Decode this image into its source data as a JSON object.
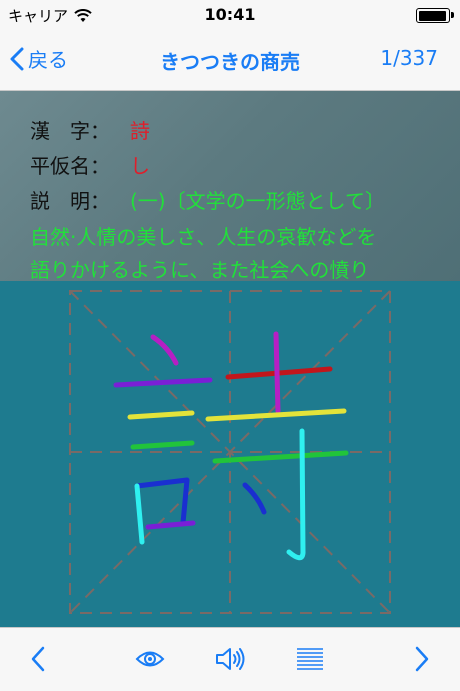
{
  "status": {
    "carrier": "キャリア",
    "time": "10:41",
    "battery_level": 0.95
  },
  "nav": {
    "back_label": "戻る",
    "title": "きつつきの商売",
    "count": "1/337"
  },
  "info": {
    "kanji_label": "漢　字：",
    "kanji_value": "詩",
    "kana_label": "平仮名：",
    "kana_value": "し",
    "desc_label": "説　明：",
    "desc_lines": [
      "(一)〔文学の一形態として〕",
      "自然·人情の美しさ、人生の哀歓などを",
      "語りかけるように、また社会への憤り"
    ]
  },
  "colors": {
    "accent": "#1a7df5",
    "content_bg": "#1e7b8f",
    "kanji_red": "#e01e2a",
    "desc_green": "#21e03a",
    "stroke_colors": [
      "#b61fc4",
      "#7a1fd6",
      "#e3e33a",
      "#21c43a",
      "#1a2fd0",
      "#2ff0f0",
      "#c2161c"
    ]
  },
  "toolbar": {
    "prev_icon": "chevron-left-icon",
    "view_icon": "eye-icon",
    "sound_icon": "speaker-icon",
    "list_icon": "list-icon",
    "next_icon": "chevron-right-icon"
  }
}
